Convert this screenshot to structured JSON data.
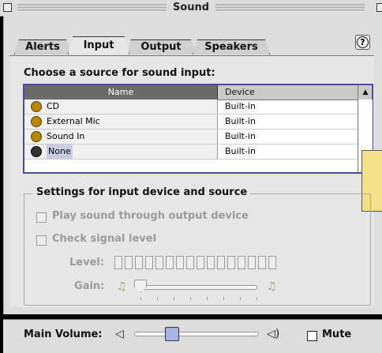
{
  "window": {
    "title": "Sound"
  },
  "tabs": [
    {
      "label": "Alerts",
      "active": false
    },
    {
      "label": "Input",
      "active": true
    },
    {
      "label": "Output",
      "active": false
    },
    {
      "label": "Speakers",
      "active": false
    }
  ],
  "help_icon": "question-mark-icon",
  "input_section": {
    "heading": "Choose a source for sound input:",
    "columns": [
      "Name",
      "Device"
    ],
    "sources": [
      {
        "name": "CD",
        "device": "Built-in",
        "icon": "microphone-icon",
        "selected": false
      },
      {
        "name": "External Mic",
        "device": "Built-in",
        "icon": "microphone-icon",
        "selected": false
      },
      {
        "name": "Sound In",
        "device": "Built-in",
        "icon": "microphone-icon",
        "selected": false
      },
      {
        "name": "None",
        "device": "Built-in",
        "icon": "microphone-off-icon",
        "selected": true
      }
    ]
  },
  "settings": {
    "group_label": "Settings for input device and source",
    "play_through_label": "Play sound through output device",
    "check_level_label": "Check signal level",
    "level_label": "Level:",
    "gain_label": "Gain:",
    "level_segments": 16,
    "enabled": false
  },
  "bottom": {
    "main_volume_label": "Main Volume:",
    "volume_level": 0.28,
    "mute_label": "Mute",
    "muted": false
  },
  "colors": {
    "table_border": "#4a4a99",
    "selection": "#c8cde6",
    "volume_thumb": "#a7b5e0",
    "tooltip": "#f5e08a"
  }
}
